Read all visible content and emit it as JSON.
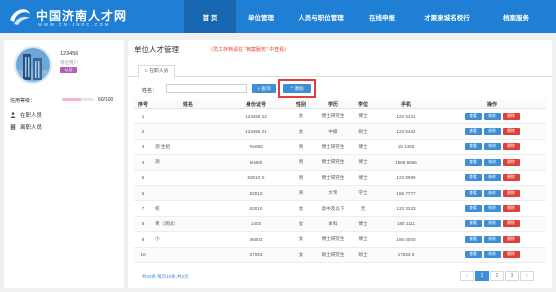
{
  "site": {
    "logo_cn": "中国济南人才网",
    "logo_url": "WWW.CN-JNRC.COM"
  },
  "nav": [
    "首 页",
    "单位管理",
    "人员与职位管理",
    "在线申报",
    "才聚泉城名校行",
    "档案服务"
  ],
  "user": {
    "name": "123456",
    "subname": "单位用户",
    "role": "认证",
    "credit_label": "信用等级：",
    "credit_score": "60/100",
    "credit_fraction": 0.6
  },
  "sidebar": {
    "items": [
      {
        "label": "在职人员",
        "icon": "person-icon"
      },
      {
        "label": "离职人员",
        "icon": "doc-icon"
      }
    ]
  },
  "page": {
    "title": "单位人才管理",
    "notice": "（员工存档请在 “档案服务” 中查看）",
    "tab": "在职人员"
  },
  "search": {
    "label": "姓名：",
    "placeholder": "",
    "search_btn": "查询",
    "add_btn": "添加"
  },
  "table": {
    "headers": [
      "序号",
      "姓名",
      "身份证号",
      "性别",
      "学历",
      "学位",
      "手机",
      "操作"
    ],
    "rows": [
      [
        "1",
        "",
        "123456     22",
        "女",
        "博士研究生",
        "博士",
        "123      5431"
      ],
      [
        "2",
        "",
        "123456     21",
        "女",
        "中级",
        "硕士",
        "123      5432"
      ],
      [
        "3",
        "测     生组",
        "Test65",
        "男",
        "博士研究生",
        "博士",
        "15      1456"
      ],
      [
        "4",
        "测     ",
        "test6h",
        "男",
        "博士研究生",
        "博士",
        "1566      6666"
      ],
      [
        "5",
        "",
        "63010      X",
        "男",
        "博士研究生",
        "博士",
        "123      9999"
      ],
      [
        "6",
        "",
        "63010",
        "男",
        "大专",
        "学士",
        "155      7777"
      ],
      [
        "7",
        "校",
        "63010",
        "女",
        "高中及以下",
        "无",
        "133      3333"
      ],
      [
        "8",
        "    青（测试）",
        "1403",
        "女",
        "本科",
        "博士",
        "180      1111"
      ],
      [
        "9",
        "小     ",
        "46003",
        "女",
        "博士研究生",
        "博士",
        "186      0000"
      ],
      [
        "10",
        "",
        "37063",
        "女",
        "硕士研究生",
        "硕士",
        "17563      6"
      ]
    ],
    "ops": {
      "view": "查看",
      "edit": "修改",
      "del": "删除"
    }
  },
  "footer": {
    "info": "共20条,每页10条,共2页"
  },
  "pager": [
    "‹",
    "1",
    "2",
    "3",
    "›"
  ],
  "colors": {
    "header": "#1e7fd4",
    "primary": "#3e8ed6",
    "danger": "#e0403a",
    "badge": "#b05fb1"
  }
}
